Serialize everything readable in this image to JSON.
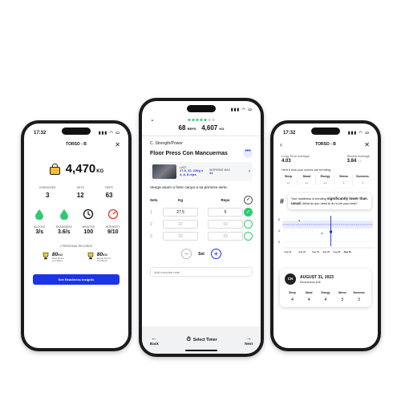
{
  "left": {
    "status_time": "17:32",
    "status_icons": "▮▮▮ ◠ ▭",
    "title": "TORSO - B",
    "close": "✕",
    "tonnage": "4,470",
    "tonnage_unit": "KG",
    "stats": [
      {
        "label": "EXERCISES",
        "value": "3"
      },
      {
        "label": "SETS",
        "value": "12"
      },
      {
        "label": "REPS",
        "value": "63"
      }
    ],
    "icon_stats": [
      {
        "icon": "blocks-drop-icon",
        "label": "BLOCKS",
        "value": "3/s"
      },
      {
        "icon": "readiness-drop-icon",
        "label": "READINESS",
        "value": "3.6/s"
      },
      {
        "icon": "clock-icon",
        "label": "MINUTES",
        "value": "100"
      },
      {
        "icon": "gauge-icon",
        "label": "INTENSITY",
        "value": "9/10"
      }
    ],
    "records_title": "2 PERSONAL RECORDS",
    "records": [
      {
        "value": "80",
        "unit": "KG",
        "detail_1": "Rest Remo",
        "detail_2": "con Barra"
      },
      {
        "value": "80",
        "unit": "KG",
        "detail_1": "Elevar Remo",
        "detail_2": "con Barra"
      }
    ],
    "button": "See Readiness Insights"
  },
  "mid": {
    "status_time": "",
    "status_icons": "▮▮▮ ◠ ▭",
    "back": "⌄",
    "reps": "68",
    "reps_unit": "REPS",
    "weight": "4,607",
    "weight_unit": "KG",
    "section": "C. Strength/Power",
    "exercise": "Floor Press Con Mancuernas",
    "more": "•••",
    "last_label": "LAST",
    "last_value_1": "27.5, 22, 22kg x",
    "last_value_2": "4, 8, 8 reps",
    "working_max_label": "WORKING MAX",
    "working_max_value": "31",
    "notes": "Venga anam a fotre canya a sa primera serie.",
    "col_sets": "Sets",
    "col_kg": "Kg",
    "col_reps": "Reps",
    "rows": [
      {
        "n": "1",
        "kg": "27.5",
        "reps": "5"
      },
      {
        "n": "2",
        "kg": "22",
        "reps": "10"
      },
      {
        "n": "3",
        "kg": "22",
        "reps": "10"
      }
    ],
    "set_label": "Set",
    "minus": "−",
    "plus": "+",
    "notes_placeholder": "Add exercise note",
    "nav_back": "Back",
    "nav_timer": "Select Timer",
    "nav_next": "Next"
  },
  "right": {
    "status_time": "17:32",
    "status_icons": "▮▮▮ ◠ ▭",
    "title": "TORSO - B",
    "close": "✕",
    "back": "‹",
    "long_term_label": "Long-Term Average",
    "long_term_value": "4.03",
    "recent_label": "Recent Average",
    "recent_value": "3.84",
    "recent_trend": "↓↓",
    "trend_label": "Here's how your scores are trending:",
    "metrics": [
      {
        "label": "Sleep",
        "arrow": "↔",
        "red": false
      },
      {
        "label": "Mood",
        "arrow": "↔",
        "red": false
      },
      {
        "label": "Energy",
        "arrow": "↔",
        "red": false
      },
      {
        "label": "Stress",
        "arrow": "↓",
        "red": true
      },
      {
        "label": "Soreness",
        "arrow": "↓",
        "red": true
      }
    ],
    "hash": "#",
    "tooltip_1": "Your readiness is trending ",
    "tooltip_bold": "significantly lower than usual.",
    "tooltip_2": " What do you need to do to be your best?",
    "chart_y_labels": [
      "5",
      "4",
      "3"
    ],
    "chart_x_labels": [
      "Aug 16",
      "Aug 22",
      "Aug 25",
      "Aug 25",
      "Aug 28",
      "Aug 31"
    ],
    "date_badge": "CN",
    "date": "AUGUST 31, 2023",
    "readiness_label": "Readiness",
    "readiness_value": "2.6",
    "scores": [
      {
        "label": "Sleep",
        "value": "4"
      },
      {
        "label": "Mood",
        "value": "4"
      },
      {
        "label": "Energy",
        "value": "4"
      },
      {
        "label": "Stress",
        "value": "3"
      },
      {
        "label": "Soreness",
        "value": "3"
      }
    ]
  },
  "colors": {
    "accent_blue": "#1d33e6",
    "success_green": "#2ecc71",
    "kettle_yellow": "#f2c230",
    "alert_red": "#e33333"
  }
}
